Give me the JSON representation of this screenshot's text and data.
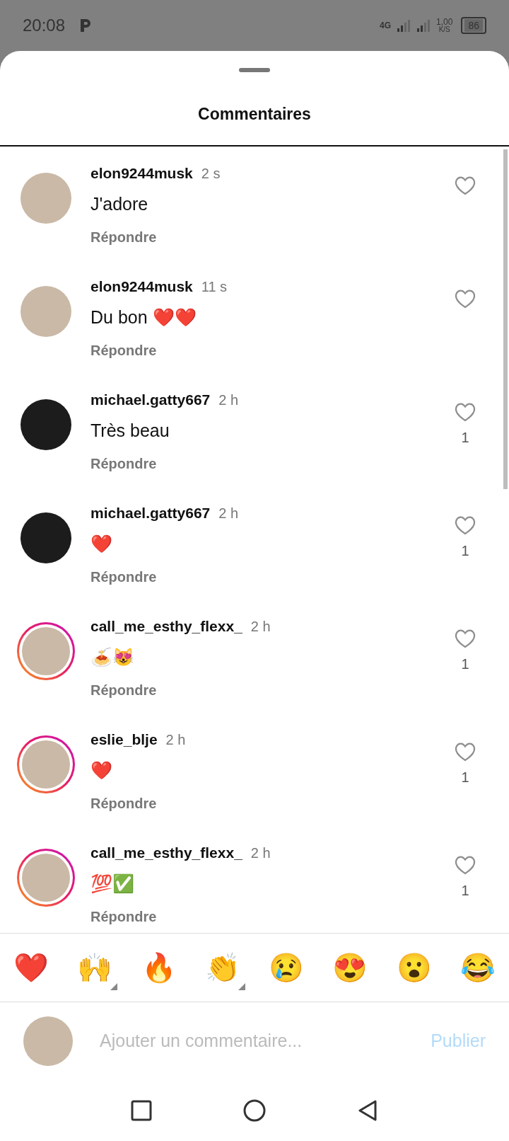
{
  "status_bar": {
    "time": "20:08",
    "network": "4G",
    "speed": "1,00",
    "speed_unit": "K/S",
    "battery": "86"
  },
  "sheet": {
    "title": "Commentaires"
  },
  "comments": [
    {
      "username": "elon9244musk",
      "time": "2 s",
      "text": "J'adore",
      "reply": "Répondre",
      "story_ring": false,
      "kind": "light"
    },
    {
      "username": "elon9244musk",
      "time": "11 s",
      "text": "Du bon ❤️❤️",
      "reply": "Répondre",
      "story_ring": false,
      "kind": "light"
    },
    {
      "username": "michael.gatty667",
      "time": "2 h",
      "text": "Très beau",
      "reply": "Répondre",
      "likes": "1",
      "story_ring": false,
      "kind": "dark"
    },
    {
      "username": "michael.gatty667",
      "time": "2 h",
      "text": "❤️",
      "reply": "Répondre",
      "likes": "1",
      "story_ring": false,
      "kind": "dark"
    },
    {
      "username": "call_me_esthy_flexx_",
      "time": "2 h",
      "text": "🍝😻",
      "reply": "Répondre",
      "likes": "1",
      "story_ring": true,
      "kind": "light"
    },
    {
      "username": "eslie_blje",
      "time": "2 h",
      "text": "❤️",
      "reply": "Répondre",
      "likes": "1",
      "story_ring": true,
      "kind": "light"
    },
    {
      "username": "call_me_esthy_flexx_",
      "time": "2 h",
      "text": "💯✅",
      "reply": "Répondre",
      "likes": "1",
      "story_ring": true,
      "kind": "light"
    }
  ],
  "reactions": [
    {
      "emoji": "❤️",
      "variants": false
    },
    {
      "emoji": "🙌",
      "variants": true
    },
    {
      "emoji": "🔥",
      "variants": false
    },
    {
      "emoji": "👏",
      "variants": true
    },
    {
      "emoji": "😢",
      "variants": false
    },
    {
      "emoji": "😍",
      "variants": false
    },
    {
      "emoji": "😮",
      "variants": false
    },
    {
      "emoji": "😂",
      "variants": false
    }
  ],
  "composer": {
    "placeholder": "Ajouter un commentaire...",
    "submit": "Publier"
  }
}
